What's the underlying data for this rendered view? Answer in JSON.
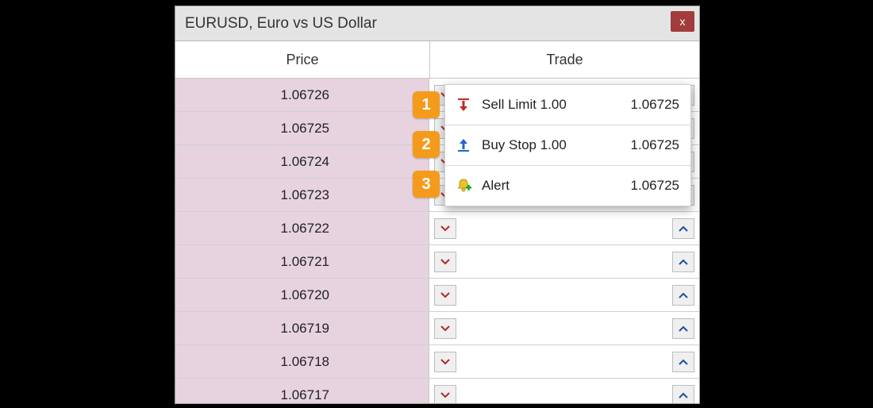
{
  "window": {
    "title": "EURUSD, Euro vs US Dollar",
    "close_glyph": "x"
  },
  "columns": {
    "price": "Price",
    "trade": "Trade"
  },
  "rows": [
    {
      "price": "1.06726"
    },
    {
      "price": "1.06725"
    },
    {
      "price": "1.06724"
    },
    {
      "price": "1.06723"
    },
    {
      "price": "1.06722"
    },
    {
      "price": "1.06721"
    },
    {
      "price": "1.06720"
    },
    {
      "price": "1.06719"
    },
    {
      "price": "1.06718"
    },
    {
      "price": "1.06717"
    }
  ],
  "context_menu": {
    "items": [
      {
        "label": "Sell Limit 1.00",
        "price": "1.06725",
        "icon": "sell-limit-icon"
      },
      {
        "label": "Buy Stop 1.00",
        "price": "1.06725",
        "icon": "buy-stop-icon"
      },
      {
        "label": "Alert",
        "price": "1.06725",
        "icon": "alert-icon"
      }
    ]
  },
  "callouts": {
    "b1": "1",
    "b2": "2",
    "b3": "3"
  },
  "colors": {
    "accent_close": "#a23b3b",
    "price_bg": "#e7d3df",
    "sell_red": "#c62828",
    "buy_blue": "#1e66d0",
    "callout_orange": "#f59b1b",
    "alert_yellow": "#e8c22a",
    "alert_plus": "#1ea51a"
  }
}
